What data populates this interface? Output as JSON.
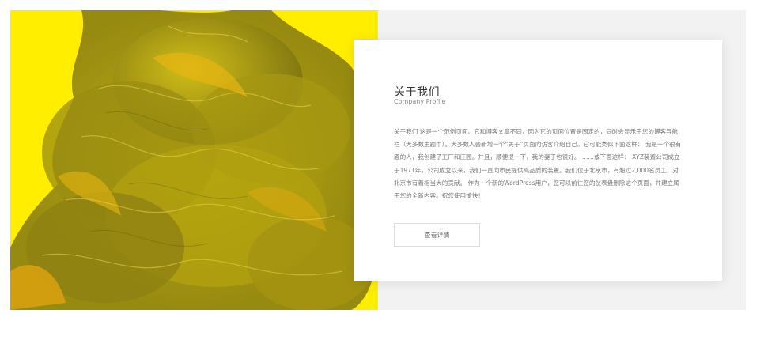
{
  "about": {
    "title": "关于我们",
    "subtitle": "Company Profile",
    "body": "关于我们 这是一个范例页面。它和博客文章不同，因为它的页面位置是固定的，同时会显示于您的博客导航栏（大多数主题中）。大多数人会新增一个“关于”页面向访客介绍自己。它可能类似下面这样： 我是一个很有趣的人，我创建了工厂和庄园。并且，顺便提一下，我的妻子也很好。 ……或下面这样： XYZ装置公司成立于1971年，公司成立以来，我们一直向市民提供高品质的装置。我们位于北京市，有超过2,000名员工，对北京市有着相当大的贡献。 作为一个新的WordPress用户，您可以前往您的仪表盘删除这个页面，并建立属于您的全新内容。祝您使用愉快！",
    "button_label": "查看详情"
  },
  "hero": {
    "icon": "yellow-ink-smoke-image",
    "colors": {
      "background": "#ffee00",
      "smoke_light": "#c9b70a",
      "smoke_dark": "#7d7410",
      "highlight": "#e7b511"
    }
  }
}
